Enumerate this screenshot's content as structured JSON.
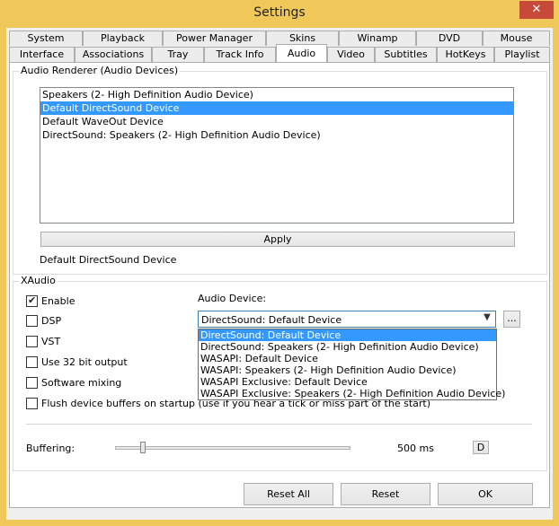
{
  "window": {
    "title": "Settings",
    "close_glyph": "✕"
  },
  "tabs_back": [
    "System",
    "Playback",
    "Power Manager",
    "Skins",
    "Winamp",
    "DVD",
    "Mouse"
  ],
  "tabs_front": [
    "Interface",
    "Associations",
    "Tray",
    "Track Info",
    "Audio",
    "Video",
    "Subtitles",
    "HotKeys",
    "Playlist"
  ],
  "active_tab": "Audio",
  "renderer": {
    "group_label": "Audio Renderer (Audio Devices)",
    "devices": [
      "Speakers (2- High Definition Audio Device)",
      "Default DirectSound Device",
      "Default WaveOut Device",
      "DirectSound: Speakers (2- High Definition Audio Device)"
    ],
    "selected_index": 1,
    "apply_label": "Apply",
    "current_device": "Default DirectSound Device"
  },
  "xaudio": {
    "group_label": "XAudio",
    "enable_label": "Enable",
    "enable_checked": true,
    "dsp_label": "DSP",
    "vst_label": "VST",
    "bit32_label": "Use 32 bit output",
    "software_mixing_label": "Software mixing",
    "flush_label": "Flush device buffers on startup (use if you hear a tick or miss part of the start)",
    "device_label": "Audio Device:",
    "device_value": "DirectSound: Default Device",
    "browse_label": "...",
    "device_options": [
      "DirectSound: Default Device",
      "DirectSound: Speakers (2- High Definition Audio Device)",
      "WASAPI: Default Device",
      "WASAPI: Speakers (2- High Definition Audio Device)",
      "WASAPI Exclusive: Default Device",
      "WASAPI Exclusive: Speakers (2- High Definition Audio Device)"
    ],
    "device_option_selected": 0,
    "buffering_label": "Buffering:",
    "buffering_value": "500 ms",
    "buffering_fraction": 0.11,
    "default_btn_label": "D"
  },
  "footer": {
    "reset_all_label": "Reset All",
    "reset_label": "Reset",
    "ok_label": "OK"
  }
}
